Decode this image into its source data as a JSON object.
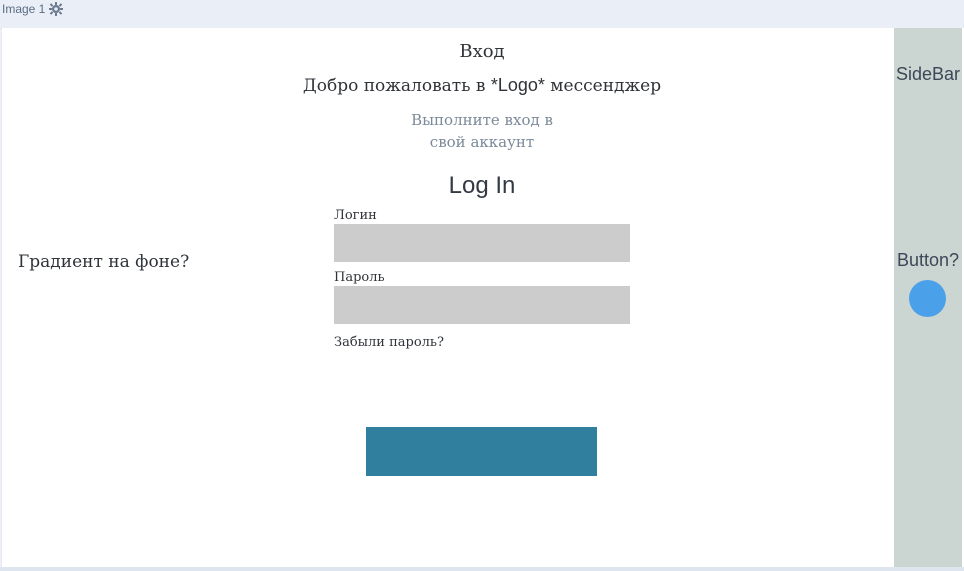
{
  "tab": {
    "label": "Image 1",
    "settings_icon": "gear-icon"
  },
  "content": {
    "title": "Вход",
    "welcome_prefix": "Добро пожаловать в ",
    "welcome_logo": "*Logo*",
    "welcome_suffix": " мессенджер",
    "subtitle_line1": "Выполните вход в",
    "subtitle_line2": "свой аккаунт",
    "login_heading": "Log In",
    "gradient_note": "Градиент на фоне?",
    "login_label": "Логин",
    "login_value": "",
    "password_label": "Пароль",
    "password_value": "",
    "forgot_label": "Забыли пароль?"
  },
  "sidebar": {
    "title": "SideBar",
    "button_label": "Button?"
  },
  "colors": {
    "sidebar_bg": "#cbd5d1",
    "accent_button": "#317f9e",
    "circle": "#4aa1ea",
    "input_bg": "#cccccc"
  }
}
